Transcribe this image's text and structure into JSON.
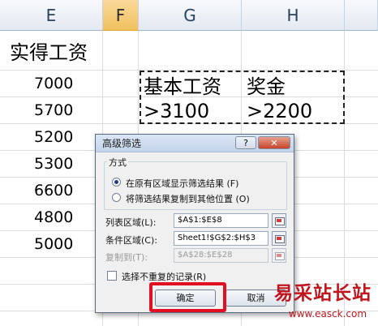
{
  "columns": [
    {
      "letter": "E",
      "selected": false
    },
    {
      "letter": "F",
      "selected": true
    },
    {
      "letter": "G",
      "selected": false
    },
    {
      "letter": "H",
      "selected": false
    }
  ],
  "sheet": {
    "e_header": "实得工资",
    "e_values": [
      "7000",
      "5700",
      "5200",
      "5300",
      "6600",
      "4800",
      "5000"
    ],
    "criteria": {
      "g_header": "基本工资",
      "h_header": "奖金",
      "g_value": ">3100",
      "h_value": ">2200"
    }
  },
  "dialog": {
    "title": "高级筛选",
    "help_label": "?",
    "close_label": "✕",
    "mode_group_label": "方式",
    "mode_options": [
      {
        "label": "在原有区域显示筛选结果 (F)",
        "selected": true
      },
      {
        "label": "将筛选结果复制到其他位置 (O)",
        "selected": false
      }
    ],
    "list_range_label": "列表区域(L):",
    "list_range_value": "$A$1:$E$8",
    "criteria_range_label": "条件区域(C):",
    "criteria_range_value": "Sheet1!$G$2:$H$3",
    "copy_to_label": "复制到(T):",
    "copy_to_value": "$A$28:$E$28",
    "unique_label": "选择不重复的记录(R)",
    "unique_checked": false,
    "ok_label": "确定",
    "cancel_label": "取消"
  },
  "watermark": {
    "title": "易采站长站",
    "url": "www.easck.com"
  },
  "colors": {
    "selected_column_header": "#f1c15f",
    "highlight_box": "#e10f1f",
    "watermark_red": "#c0151d"
  },
  "icons": [
    "help-icon",
    "close-icon",
    "range-select-icon"
  ]
}
